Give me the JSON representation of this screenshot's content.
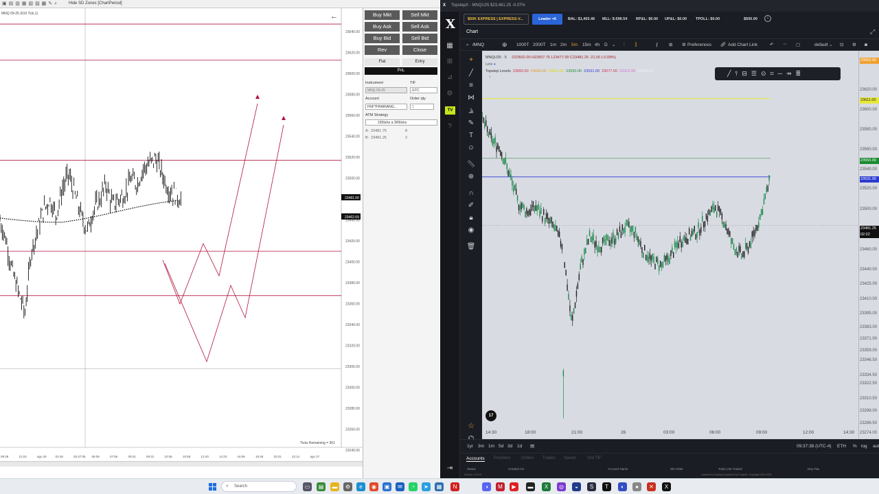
{
  "left_window": {
    "title": "Hide SD Zones [ChartPeriod]",
    "chart_label": "MNQ 09-25 (610 Tick,1)",
    "ticks_remaining": "Ticks Remaining = 361",
    "price_ticks": [
      "23640.00",
      "23620.00",
      "23600.00",
      "23580.00",
      "23560.00",
      "23540.00",
      "23520.00",
      "23500.00",
      "23462.69",
      "23440.00",
      "23420.00",
      "23400.00",
      "23380.00",
      "23360.00",
      "23340.00",
      "23320.00",
      "23306.00",
      "23300.00",
      "23280.00",
      "23260.00",
      "23240.00"
    ],
    "current_price": "23481.00",
    "current_price2": "23462.69",
    "time_ticks": [
      "09:39",
      "21:02",
      "ago 26",
      "02:49",
      "03:47:05",
      "06:09",
      "07:56",
      "09:01",
      "09:31",
      "10:36",
      "10:58",
      "12:40",
      "14:23",
      "16:06",
      "18:48",
      "20:31",
      "22:14",
      "ago 27"
    ]
  },
  "order_panel": {
    "buy_mkt": "Buy Mkt",
    "sell_mkt": "Sell Mkt",
    "buy_ask": "Buy Ask",
    "sell_ask": "Sell Ask",
    "buy_bid": "Buy Bid",
    "sell_bid": "Sell Bid",
    "rev": "Rev",
    "close": "Close",
    "flat": "Flat",
    "entry": "Entry",
    "pnl": "PnL",
    "instrument_label": "Instrument",
    "instrument_value": "MNQ 09-25",
    "tif_label": "TIF",
    "tif_value": "GTC",
    "account_label": "Account",
    "account_value": "FNFTFRARIANG...",
    "order_qty_label": "Order qty",
    "order_qty_value": "1",
    "atm_label": "ATM Strategy",
    "atm_value": "150ticks a 300ticks",
    "ask_label": "A:",
    "ask_price": "23481.75",
    "ask_qty": "8",
    "bid_label": "B:",
    "bid_price": "23481.25",
    "bid_qty": "2"
  },
  "right_window": {
    "title": "TopstepX - MNQU25 $23,481.25 -0.07%",
    "account_button": "$50K EXPRESS | EXPRESS-V...",
    "leader_button": "Leader +6",
    "bal": "BAL: $1,403.46",
    "mll": "MLL: $-596.54",
    "rpl": "RP&L: $0.00",
    "upl": "UP&L: $0.00",
    "tpoll": "TPOLL: $0.00",
    "goal": "$500.00",
    "tab_chart": "Chart",
    "symbol": "/MNQ",
    "intervals": [
      "1000T",
      "2000T",
      "1m",
      "2m",
      "5m",
      "15m",
      "4h",
      "D"
    ],
    "active_interval": "5m",
    "preferences": "Preferences",
    "add_chart_link": "Add Chart Link",
    "layout": "default",
    "legend_symbol": "MNQU25 · 5",
    "legend_ohlc": "O23502.00 H23507.75 L23477.00 C23481.25 -21.00 (-0.09%)",
    "legend_link": "Link",
    "legend_levels_label": "Topstep Levels",
    "legend_levels": [
      {
        "v": "23892.00",
        "c": "#d0304a"
      },
      {
        "v": "23650.00",
        "c": "#e09a20"
      },
      {
        "v": "23611.00",
        "c": "#d8d800"
      },
      {
        "v": "23550.00",
        "c": "#208a30"
      },
      {
        "v": "23531.00",
        "c": "#2a3ad0"
      },
      {
        "v": "23077.00",
        "c": "#d0304a"
      },
      {
        "v": "23312.00",
        "c": "#d070d0"
      },
      {
        "v": "23035.00",
        "c": "#f0f0f0"
      }
    ],
    "price_axis": [
      "23650.00",
      "23620.00",
      "23611.00",
      "23600.00",
      "23580.00",
      "23560.00",
      "23550.00",
      "23540.00",
      "23531.00",
      "23520.00",
      "23500.00",
      "23481.25",
      "02:22",
      "23460.00",
      "23440.00",
      "23425.00",
      "23410.00",
      "23395.00",
      "23383.00",
      "23371.00",
      "23359.00",
      "23346.50",
      "23334.50",
      "23322.50",
      "23310.50",
      "23298.00",
      "23286.50",
      "23274.00"
    ],
    "time_axis": [
      "14:30",
      "18:00",
      "21:00",
      "26",
      "03:00",
      "06:00",
      "09:00",
      "12:00",
      "14:30"
    ],
    "ranges": [
      "1yr",
      "3m",
      "1m",
      "5d",
      "3d",
      "1d"
    ],
    "clock": "09:37:38 (UTC-4)",
    "session": "ETH",
    "pct": "%",
    "log": "log",
    "auto": "auto",
    "accounts_tab": "Accounts",
    "bottom_tabs": [
      "Positions",
      "Orders",
      "Trades",
      "Saved",
      "Ord TIF"
    ],
    "cols": [
      "Status",
      "Created On",
      "Account Name",
      "Win Rate",
      "Total Lots Traded",
      "Day P&L"
    ],
    "version": "Version: 1.20.10",
    "license": "Licensed to Topstep & powered by ProjectX. Copyright 2024-2025"
  },
  "taskbar": {
    "search": "Search"
  },
  "chart_data": [
    {
      "type": "line",
      "title": "",
      "ylim": [
        23230,
        23650
      ],
      "levels": [
        23640,
        23605,
        23508,
        23420,
        23377,
        23306
      ],
      "current_price": 23481,
      "series_points": [
        23450,
        23430,
        23400,
        23380,
        23360,
        23420,
        23440,
        23460,
        23470,
        23455,
        23480,
        23495,
        23475,
        23455,
        23440,
        23460,
        23470,
        23485,
        23465,
        23470,
        23475,
        23490,
        23485,
        23500,
        23505,
        23510,
        23495,
        23480,
        23475,
        23470
      ]
    },
    {
      "type": "line",
      "title": "",
      "ylim": [
        23274,
        23660
      ],
      "levels": [
        23611,
        23550,
        23531
      ],
      "current_price": 23481.25,
      "series_points": [
        23590,
        23570,
        23560,
        23535,
        23505,
        23495,
        23500,
        23490,
        23480,
        23460,
        23380,
        23440,
        23470,
        23460,
        23465,
        23470,
        23480,
        23475,
        23455,
        23445,
        23440,
        23450,
        23465,
        23470,
        23475,
        23490,
        23500,
        23485,
        23460,
        23450,
        23465,
        23490,
        23525
      ]
    }
  ]
}
